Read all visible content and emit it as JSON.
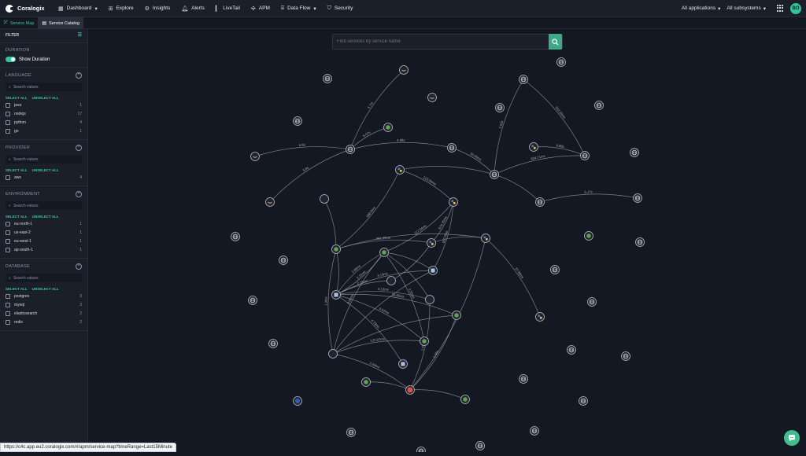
{
  "app": {
    "name": "Coralogix"
  },
  "nav": [
    {
      "label": "Dashboard",
      "icon": "dashboard-icon",
      "dropdown": true
    },
    {
      "label": "Explore",
      "icon": "explore-icon",
      "dropdown": false
    },
    {
      "label": "Insights",
      "icon": "insights-icon",
      "dropdown": false
    },
    {
      "label": "Alerts",
      "icon": "bell-icon",
      "dropdown": false
    },
    {
      "label": "LiveTail",
      "icon": "livetail-icon",
      "dropdown": false
    },
    {
      "label": "APM",
      "icon": "apm-icon",
      "dropdown": false
    },
    {
      "label": "Data Flow",
      "icon": "dataflow-icon",
      "dropdown": true
    },
    {
      "label": "Security",
      "icon": "shield-icon",
      "dropdown": false
    }
  ],
  "header_right": {
    "applications": "All applications",
    "subsystems": "All subsystems",
    "avatar_initials": "BO"
  },
  "tabs": [
    {
      "label": "Service Map"
    },
    {
      "label": "Service Catalog"
    }
  ],
  "sidebar": {
    "filter_label": "FILTER",
    "duration": {
      "title": "DURATION",
      "toggle_label": "Show Duration",
      "on": true
    },
    "select_all": "SELECT ALL",
    "unselect_all": "UNSELECT ALL",
    "search_placeholder": "Search values",
    "sections": [
      {
        "title": "LANGUAGE",
        "options": [
          {
            "label": "java",
            "count": "1"
          },
          {
            "label": "nodejs",
            "count": "17"
          },
          {
            "label": "python",
            "count": "4"
          },
          {
            "label": "go",
            "count": "1"
          }
        ]
      },
      {
        "title": "PROVIDER",
        "options": [
          {
            "label": "aws",
            "count": "4"
          }
        ]
      },
      {
        "title": "ENVIRONMENT",
        "options": [
          {
            "label": "eu-north-1",
            "count": "1"
          },
          {
            "label": "us-east-2",
            "count": "1"
          },
          {
            "label": "eu-west-1",
            "count": "1"
          },
          {
            "label": "ap-south-1",
            "count": "1"
          }
        ]
      },
      {
        "title": "DATABASE",
        "options": [
          {
            "label": "postgres",
            "count": "3"
          },
          {
            "label": "mysql",
            "count": "3"
          },
          {
            "label": "elasticsearch",
            "count": "2"
          },
          {
            "label": "redis",
            "count": "2"
          }
        ]
      }
    ]
  },
  "map": {
    "search_placeholder": "Find services by service name",
    "colors": {
      "edge": "#9aa1ad",
      "node_stroke": "#b7bcc6",
      "nodejs": "#5ea64b",
      "python": "#f2c94c",
      "error": "#e0523c"
    },
    "edge_labels": [
      "5.7m",
      "6.07s",
      "4.98s",
      "5.8s",
      "5.8s",
      "50.06ms",
      "1.62s",
      "503.28ms",
      "6.88s",
      "834.71ms",
      "6.17s",
      "600.8ms",
      "123.84ms",
      "117.54ms",
      "574.35ms",
      "481.39ms",
      "2.31ms",
      "650.5ms",
      "37.98ms",
      "2.98ms",
      "3.13ms",
      "8.13ms",
      "3.66ms",
      "4.79ms",
      "2.55ms",
      "1.43ms",
      "30.86ms",
      "125.87ms",
      "3.02ms",
      "2.63ms",
      "1.08s",
      "2.73ms",
      "1.3ms"
    ]
  },
  "status_url": "https://c4c.app.eu2.coralogix.com/#/apm/service-map?timeRange=Last15Minute"
}
